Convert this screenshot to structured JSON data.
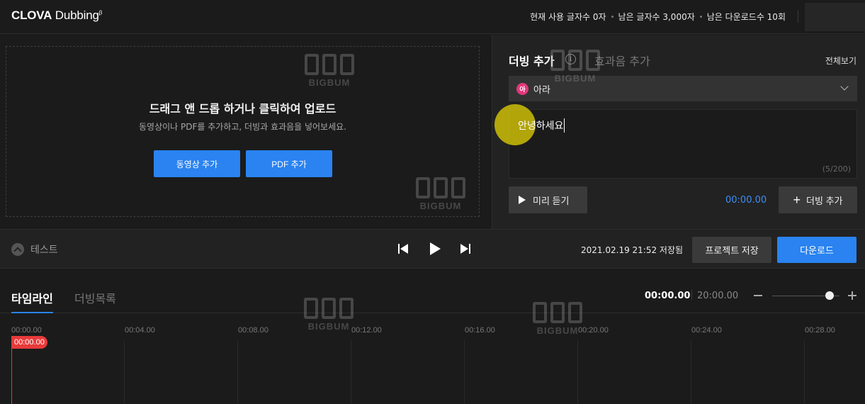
{
  "header": {
    "logo_brand": "CLOVA",
    "logo_product": "Dubbing",
    "logo_sup": "β",
    "usage": [
      "현재 사용 글자수 0자",
      "남은 글자수 3,000자",
      "남은 다운로드수 10회"
    ]
  },
  "upload": {
    "title": "드래그 앤 드롭 하거나 클릭하여 업로드",
    "subtitle": "동영상이나 PDF를 추가하고, 더빙과 효과음을 넣어보세요.",
    "add_video_label": "동영상 추가",
    "add_pdf_label": "PDF 추가"
  },
  "dub_panel": {
    "tab_dub": "더빙 추가",
    "info_glyph": "i",
    "tab_sfx": "효과음 추가",
    "view_all": "전체보기",
    "voice_badge": "아",
    "voice_name": "아라",
    "text_value": "안녕하세요",
    "char_count": "(5/200)",
    "preview_label": "미리 듣기",
    "time": "00:00.00",
    "add_dub_label": "더빙 추가",
    "add_dub_plus": "+"
  },
  "player": {
    "project_name": "테스트",
    "saved_status": "2021.02.19 21:52 저장됨",
    "save_label": "프로젝트 저장",
    "download_label": "다운로드"
  },
  "timeline": {
    "tab_timeline": "타임라인",
    "tab_dub_list": "더빙목록",
    "current_time": "00:00.00",
    "total_time": "20:00.00",
    "ticks": [
      "00:00.00",
      "00:04.00",
      "00:08.00",
      "00:12.00",
      "00:16.00",
      "00:20.00",
      "00:24.00",
      "00:28.00"
    ],
    "playhead_label": "00:00.00"
  },
  "watermark": {
    "text": "BIGBUM"
  },
  "colors": {
    "accent_blue": "#2a83f0",
    "time_blue": "#3d8ff5",
    "playhead_red": "#e83a3a",
    "voice_badge": "#e2377a",
    "cursor_highlight": "#d4c406"
  }
}
